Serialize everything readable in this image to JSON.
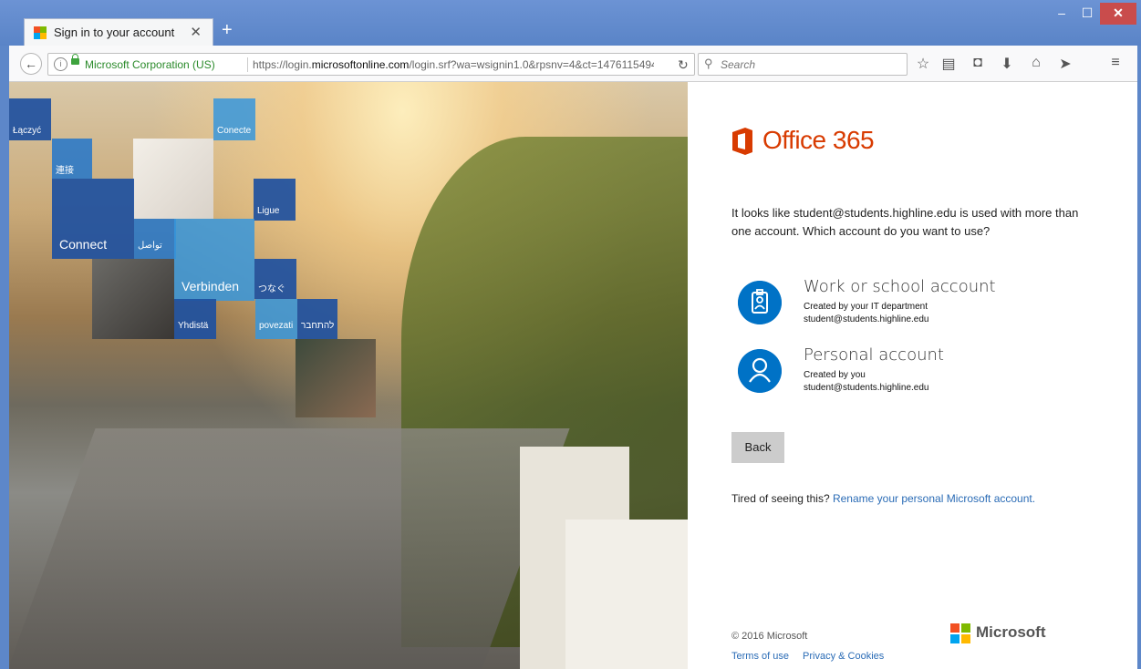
{
  "browser": {
    "tab_title": "Sign in to your account",
    "identity": "Microsoft Corporation (US)",
    "url_prefix": "https://login.",
    "url_domain": "microsoftonline.com",
    "url_suffix": "/login.srf?wa=wsignin1.0&rpsnv=4&ct=1476115494&",
    "search_placeholder": "Search"
  },
  "tiles": {
    "t1": "Łączyć",
    "t2": "Conecte",
    "t3": "連接",
    "t4": "Ligue",
    "t5": "Connect",
    "t6": "تواصل",
    "t7": "Verbinden",
    "t8": "つなぐ",
    "t9": "Yhdistä",
    "t10": "povezati",
    "t11": "להתחבר"
  },
  "page": {
    "brand": "Office 365",
    "question": "It looks like student@students.highline.edu is used with more than one account. Which account do you want to use?",
    "accounts": [
      {
        "title": "Work or school account",
        "line1": "Created by your IT department",
        "line2": "student@students.highline.edu",
        "icon": "badge-icon"
      },
      {
        "title": "Personal account",
        "line1": "Created by you",
        "line2": "student@students.highline.edu",
        "icon": "person-icon"
      }
    ],
    "back_label": "Back",
    "tired_text": "Tired of seeing this?",
    "rename_link": "Rename your personal Microsoft account.",
    "copyright": "© 2016 Microsoft",
    "terms": "Terms of use",
    "privacy": "Privacy & Cookies",
    "ms_brand": "Microsoft"
  },
  "colors": {
    "office_orange": "#d83b01",
    "account_blue": "#0072c6",
    "link_blue": "#2b6cb6"
  }
}
